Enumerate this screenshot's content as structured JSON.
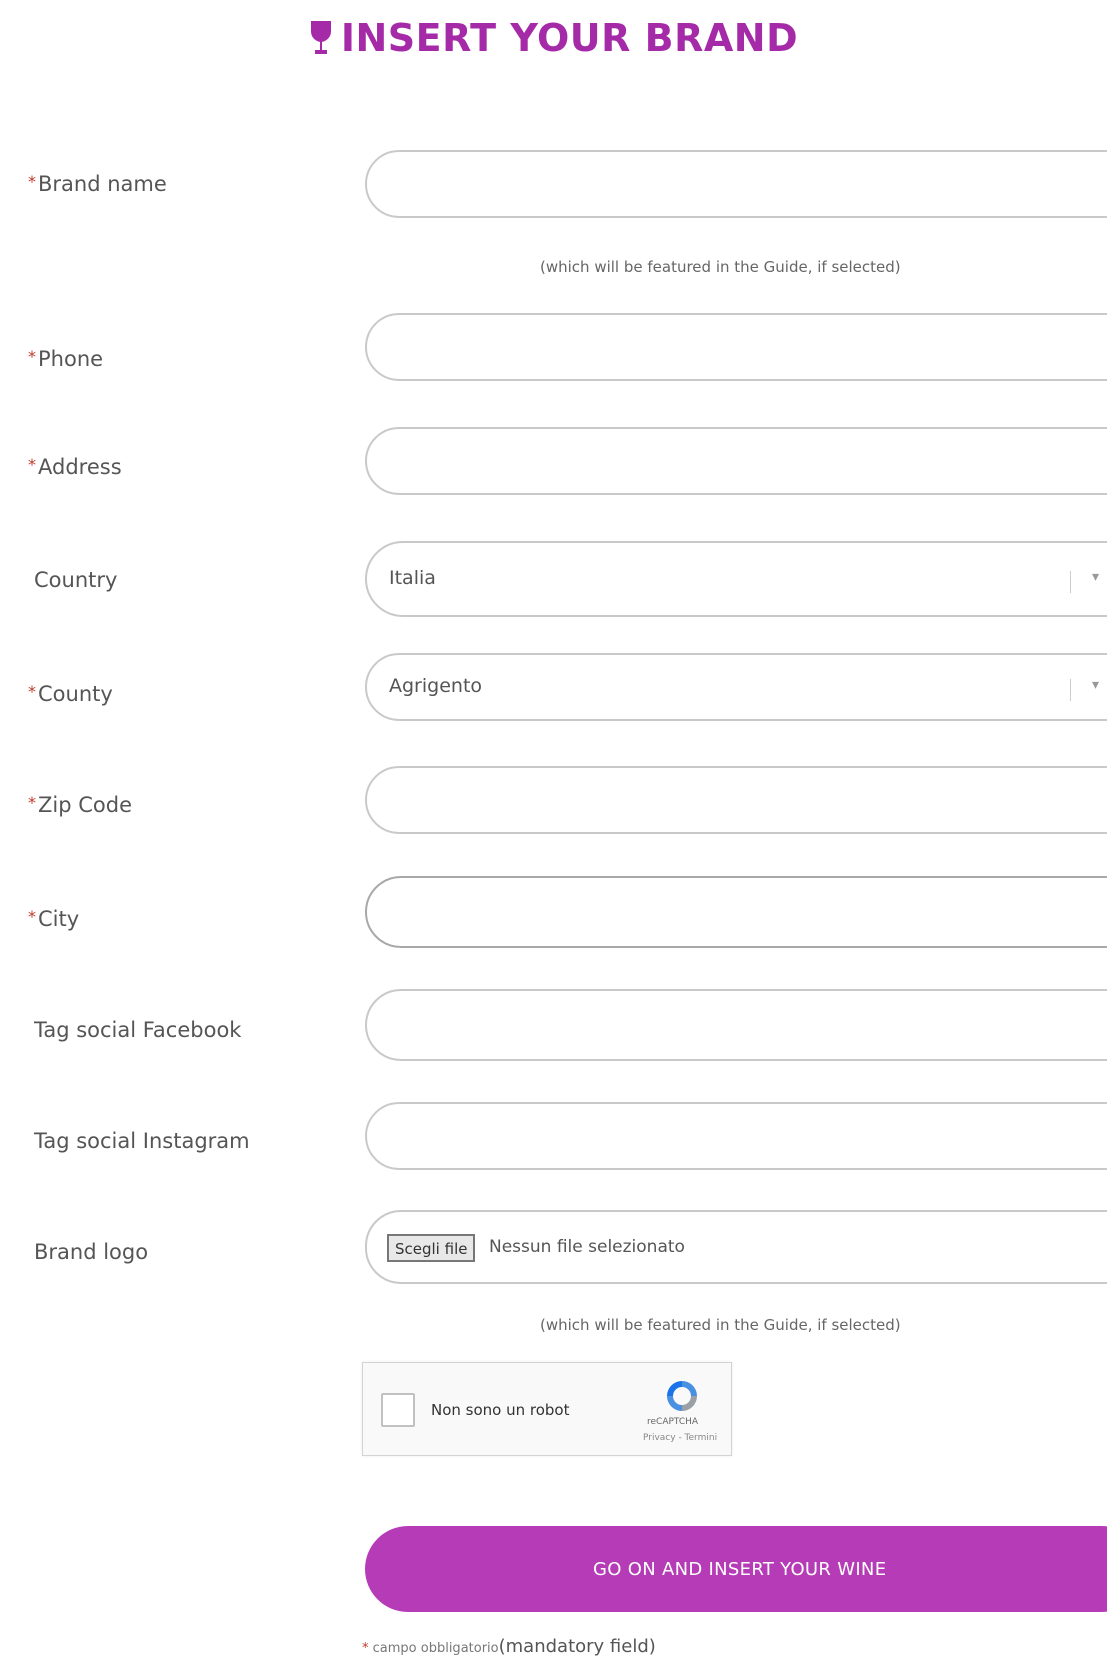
{
  "header": {
    "title": "INSERT YOUR BRAND"
  },
  "fields": {
    "brand_name": {
      "label": "Brand name",
      "value": "",
      "note": "(which will be featured in the Guide, if selected)"
    },
    "phone": {
      "label": "Phone",
      "value": ""
    },
    "address": {
      "label": "Address",
      "value": ""
    },
    "country": {
      "label": "Country",
      "value": "Italia"
    },
    "county": {
      "label": "County",
      "value": "Agrigento"
    },
    "zip": {
      "label": "Zip Code",
      "value": ""
    },
    "city": {
      "label": "City",
      "value": ""
    },
    "facebook": {
      "label": "Tag social Facebook",
      "value": ""
    },
    "instagram": {
      "label": "Tag social Instagram",
      "value": ""
    },
    "logo": {
      "label": "Brand logo",
      "button": "Scegli file",
      "status": "Nessun file selezionato",
      "note": "(which will be featured in the Guide, if selected)"
    }
  },
  "captcha": {
    "label": "Non sono un robot",
    "brand": "reCAPTCHA",
    "terms": "Privacy - Termini"
  },
  "submit": {
    "label": "GO ON AND INSERT YOUR WINE"
  },
  "footer": {
    "small": "campo obbligatorio",
    "big": "(mandatory field)"
  },
  "colors": {
    "accent": "#b53cb6",
    "title": "#a52aa8",
    "required": "#c0392b"
  }
}
